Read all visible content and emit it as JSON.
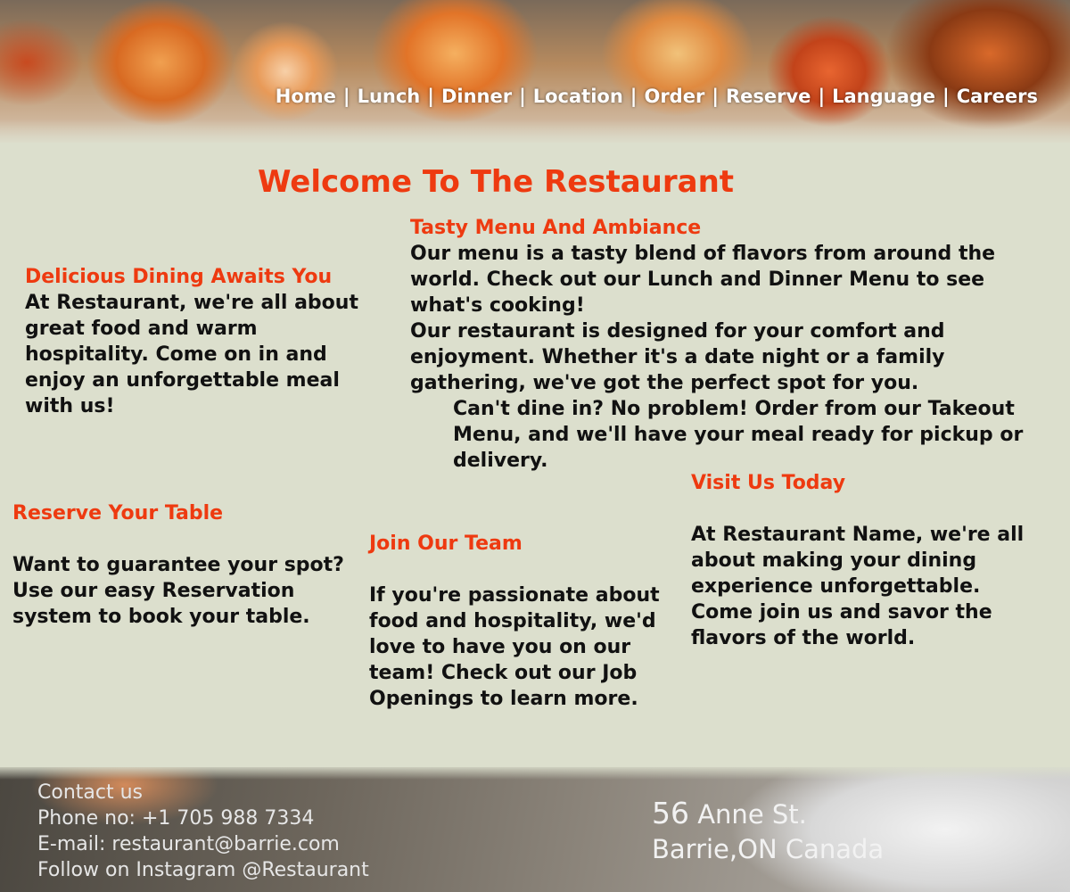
{
  "nav": {
    "items": [
      "Home",
      "Lunch",
      "Dinner",
      "Location",
      "Order",
      "Reserve",
      "Language",
      "Careers"
    ],
    "separator": "|"
  },
  "welcome_title": "Welcome To The Restaurant",
  "dining": {
    "heading": "Delicious Dining Awaits You",
    "body": "At Restaurant, we're all about great food and warm hospitality. Come on in and enjoy an unforgettable meal with us!"
  },
  "tasty": {
    "heading": "Tasty Menu And Ambiance",
    "para1": "Our menu is a tasty blend of flavors from around the world. Check out our Lunch  and Dinner Menu to see what's cooking!",
    "para2": "Our restaurant is designed for your comfort and enjoyment. Whether it's a date night or a family gathering, we've got the perfect spot for you.",
    "para3": "Can't dine in? No problem! Order from our Takeout Menu, and we'll have your meal ready for pickup or delivery."
  },
  "reserve": {
    "heading": "Reserve Your Table",
    "body": "Want to guarantee your spot? Use our easy Reservation system to book your table."
  },
  "join": {
    "heading": "Join Our Team",
    "body": "If you're passionate about food and hospitality, we'd love to have you on our team! Check out our Job Openings to learn more."
  },
  "visit": {
    "heading": "Visit Us Today",
    "body": "At Restaurant Name, we're all about making your dining experience unforgettable. Come join us and savor the flavors of the world."
  },
  "footer": {
    "contact_title": "Contact us",
    "phone": "Phone no: +1 705 988 7334",
    "email": "E-mail: restaurant@barrie.com",
    "instagram": "Follow on Instagram @Restaurant",
    "address_number": "56",
    "address_street": " Anne St.",
    "address_city": "Barrie,ON Canada"
  },
  "colors": {
    "accent": "#ee3a10",
    "background": "#dcdfcd",
    "text": "#111111",
    "nav_text": "#ffffff"
  }
}
